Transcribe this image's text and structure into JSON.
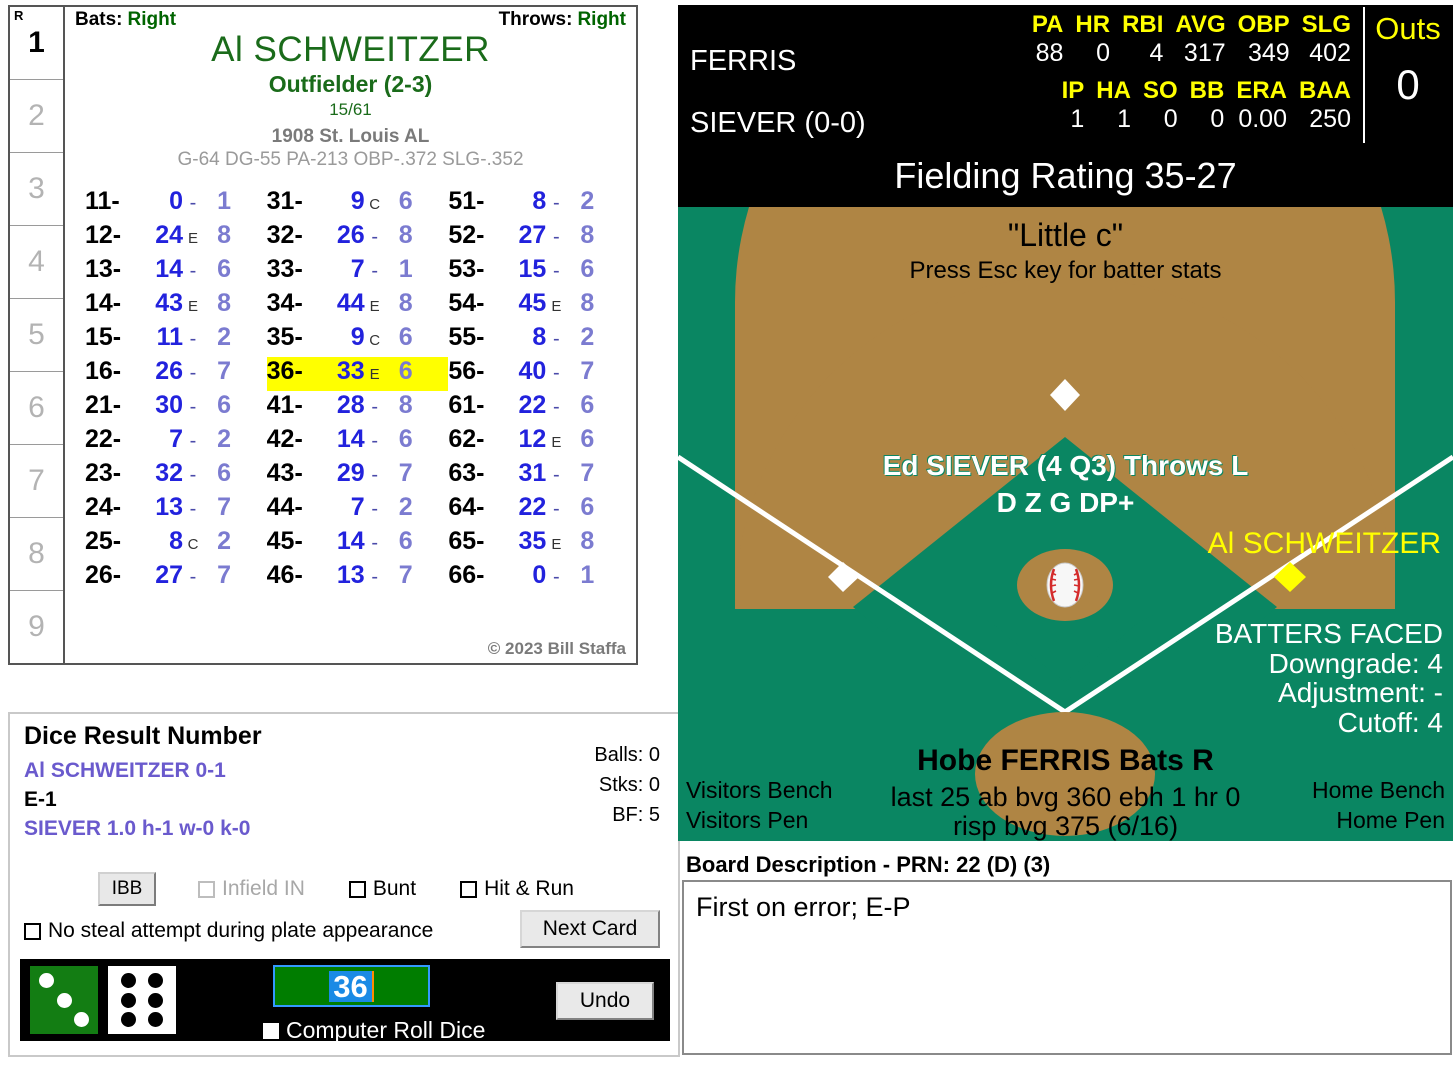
{
  "card": {
    "innings": [
      {
        "num": "1",
        "active": true,
        "header": "R"
      },
      {
        "num": "2",
        "active": false
      },
      {
        "num": "3",
        "active": false
      },
      {
        "num": "4",
        "active": false
      },
      {
        "num": "5",
        "active": false
      },
      {
        "num": "6",
        "active": false
      },
      {
        "num": "7",
        "active": false
      },
      {
        "num": "8",
        "active": false
      },
      {
        "num": "9",
        "active": false
      }
    ],
    "bats_label": "Bats:",
    "bats_value": "Right",
    "throws_label": "Throws:",
    "throws_value": "Right",
    "player_name": "Al SCHWEITZER",
    "position": "Outfielder (2-3)",
    "fraction": "15/61",
    "team": "1908 St. Louis AL",
    "stats": "G-64 DG-55 PA-213 OBP-.372 SLG-.352",
    "copyright": "© 2023 Bill Staffa",
    "highlight_roll": "36-",
    "rows": [
      {
        "roll": "11-",
        "res": "0",
        "mark": "-",
        "pow": "1"
      },
      {
        "roll": "12-",
        "res": "24",
        "mark": "E",
        "pow": "8"
      },
      {
        "roll": "13-",
        "res": "14",
        "mark": "-",
        "pow": "6"
      },
      {
        "roll": "14-",
        "res": "43",
        "mark": "E",
        "pow": "8"
      },
      {
        "roll": "15-",
        "res": "11",
        "mark": "-",
        "pow": "2"
      },
      {
        "roll": "16-",
        "res": "26",
        "mark": "-",
        "pow": "7"
      },
      {
        "roll": "21-",
        "res": "30",
        "mark": "-",
        "pow": "6"
      },
      {
        "roll": "22-",
        "res": "7",
        "mark": "-",
        "pow": "2"
      },
      {
        "roll": "23-",
        "res": "32",
        "mark": "-",
        "pow": "6"
      },
      {
        "roll": "24-",
        "res": "13",
        "mark": "-",
        "pow": "7"
      },
      {
        "roll": "25-",
        "res": "8",
        "mark": "C",
        "pow": "2"
      },
      {
        "roll": "26-",
        "res": "27",
        "mark": "-",
        "pow": "7"
      },
      {
        "roll": "31-",
        "res": "9",
        "mark": "C",
        "pow": "6"
      },
      {
        "roll": "32-",
        "res": "26",
        "mark": "-",
        "pow": "8"
      },
      {
        "roll": "33-",
        "res": "7",
        "mark": "-",
        "pow": "1"
      },
      {
        "roll": "34-",
        "res": "44",
        "mark": "E",
        "pow": "8"
      },
      {
        "roll": "35-",
        "res": "9",
        "mark": "C",
        "pow": "6"
      },
      {
        "roll": "36-",
        "res": "33",
        "mark": "E",
        "pow": "6"
      },
      {
        "roll": "41-",
        "res": "28",
        "mark": "-",
        "pow": "8"
      },
      {
        "roll": "42-",
        "res": "14",
        "mark": "-",
        "pow": "6"
      },
      {
        "roll": "43-",
        "res": "29",
        "mark": "-",
        "pow": "7"
      },
      {
        "roll": "44-",
        "res": "7",
        "mark": "-",
        "pow": "2"
      },
      {
        "roll": "45-",
        "res": "14",
        "mark": "-",
        "pow": "6"
      },
      {
        "roll": "46-",
        "res": "13",
        "mark": "-",
        "pow": "7"
      },
      {
        "roll": "51-",
        "res": "8",
        "mark": "-",
        "pow": "2"
      },
      {
        "roll": "52-",
        "res": "27",
        "mark": "-",
        "pow": "8"
      },
      {
        "roll": "53-",
        "res": "15",
        "mark": "-",
        "pow": "6"
      },
      {
        "roll": "54-",
        "res": "45",
        "mark": "E",
        "pow": "8"
      },
      {
        "roll": "55-",
        "res": "8",
        "mark": "-",
        "pow": "2"
      },
      {
        "roll": "56-",
        "res": "40",
        "mark": "-",
        "pow": "7"
      },
      {
        "roll": "61-",
        "res": "22",
        "mark": "-",
        "pow": "6"
      },
      {
        "roll": "62-",
        "res": "12",
        "mark": "E",
        "pow": "6"
      },
      {
        "roll": "63-",
        "res": "31",
        "mark": "-",
        "pow": "7"
      },
      {
        "roll": "64-",
        "res": "22",
        "mark": "-",
        "pow": "6"
      },
      {
        "roll": "65-",
        "res": "35",
        "mark": "E",
        "pow": "8"
      },
      {
        "roll": "66-",
        "res": "0",
        "mark": "-",
        "pow": "1"
      }
    ]
  },
  "scoreboard": {
    "batter_name": "FERRIS",
    "pitcher_name": "SIEVER (0-0)",
    "batter_headers": [
      "PA",
      "HR",
      "RBI",
      "AVG",
      "OBP",
      "SLG"
    ],
    "batter_values": [
      "88",
      "0",
      "4",
      "317",
      "349",
      "402"
    ],
    "pitcher_headers": [
      "IP",
      "HA",
      "SO",
      "BB",
      "ERA",
      "BAA"
    ],
    "pitcher_values": [
      "1",
      "1",
      "0",
      "0",
      "0.00",
      "250"
    ],
    "outs_label": "Outs",
    "outs_value": "0",
    "fielding_rating": "Fielding Rating 35-27"
  },
  "field": {
    "little_c": "\"Little c\"",
    "esc_hint": "Press Esc key for batter stats",
    "pitcher_line": "Ed SIEVER (4 Q3) Throws L",
    "pitcher_ratings": "D Z G DP+",
    "runner_name": "Al SCHWEITZER",
    "batters_faced_title": "BATTERS FACED",
    "downgrade": "Downgrade: 4",
    "adjustment": "Adjustment: -",
    "cutoff": "Cutoff: 4",
    "batter_line1": "Hobe FERRIS Bats R",
    "batter_line2": "last 25 ab bvg 360 ebh 1 hr 0",
    "batter_line3": "risp bvg 375 (6/16)",
    "visitors_bench": "Visitors Bench",
    "visitors_pen": "Visitors Pen",
    "home_bench": "Home Bench",
    "home_pen": "Home Pen",
    "colors": {
      "grass": "#0a8662",
      "dirt": "#af8544",
      "line": "#ffffff",
      "runner_base": "#ffff00"
    }
  },
  "dice_panel": {
    "title": "Dice Result Number",
    "line1": "Al SCHWEITZER  0-1",
    "line2": "E-1",
    "line3": "SIEVER  1.0  h-1  w-0  k-0",
    "balls": "Balls: 0",
    "strikes": "Stks: 0",
    "bf": "BF: 5",
    "ibb_label": "IBB",
    "infield_in_label": "Infield IN",
    "bunt_label": "Bunt",
    "hit_run_label": "Hit & Run",
    "no_steal_label": "No steal attempt during plate appearance",
    "next_card_label": "Next Card",
    "roll_value": "36",
    "computer_roll_label": "Computer Roll Dice",
    "undo_label": "Undo",
    "die_green_value": 3,
    "die_white_value": 6
  },
  "board": {
    "label": "Board Description - PRN: 22 (D) (3)",
    "description": "First on error; E-P"
  }
}
